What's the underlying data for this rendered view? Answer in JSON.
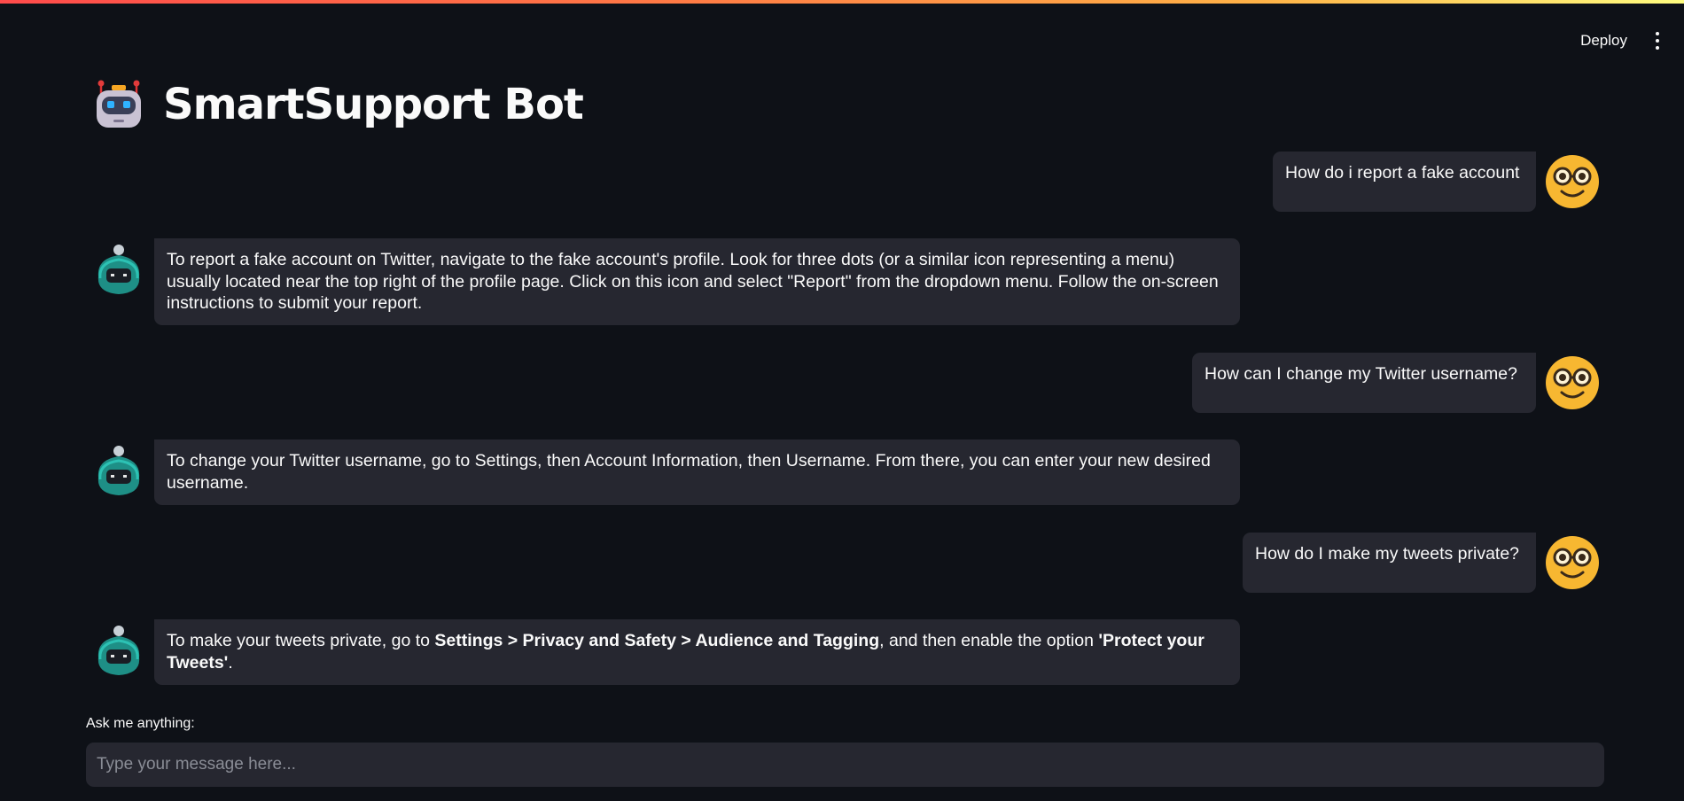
{
  "header": {
    "deploy_label": "Deploy",
    "menu_icon": "kebab-menu-icon"
  },
  "app": {
    "title": "SmartSupport Bot",
    "title_icon": "robot-face-icon"
  },
  "chat": {
    "messages": [
      {
        "role": "user",
        "avatar": "nerd-face-icon",
        "text": "How do i report a fake account"
      },
      {
        "role": "assistant",
        "avatar": "robot-avatar-icon",
        "text": "To report a fake account on Twitter, navigate to the fake account's profile. Look for three dots (or a similar icon representing a menu) usually located near the top right of the profile page. Click on this icon and select \"Report\" from the dropdown menu. Follow the on-screen instructions to submit your report."
      },
      {
        "role": "user",
        "avatar": "nerd-face-icon",
        "text": "How can I change my Twitter username?"
      },
      {
        "role": "assistant",
        "avatar": "robot-avatar-icon",
        "text": "To change your Twitter username, go to Settings, then Account Information, then Username. From there, you can enter your new desired username."
      },
      {
        "role": "user",
        "avatar": "nerd-face-icon",
        "text": "How do I make my tweets private?"
      },
      {
        "role": "assistant",
        "avatar": "robot-avatar-icon",
        "text_parts": [
          {
            "text": "To make your tweets private, go to ",
            "bold": false
          },
          {
            "text": "Settings > Privacy and Safety > Audience and Tagging",
            "bold": true
          },
          {
            "text": ", and then enable the option ",
            "bold": false
          },
          {
            "text": "'Protect your Tweets'",
            "bold": true
          },
          {
            "text": ".",
            "bold": false
          }
        ]
      }
    ]
  },
  "input": {
    "label": "Ask me anything:",
    "placeholder": "Type your message here...",
    "value": ""
  },
  "colors": {
    "background": "#0e1117",
    "bubble": "#262730",
    "text": "#fafafa",
    "user_avatar": "#f7b731",
    "bot_avatar": "#1e8f86"
  }
}
